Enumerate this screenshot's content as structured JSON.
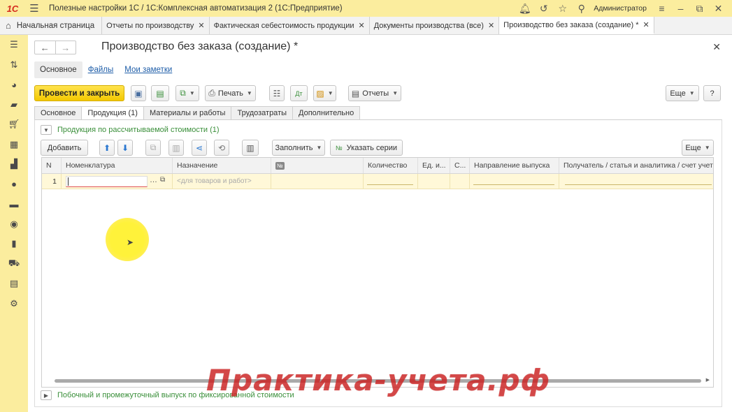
{
  "app": {
    "logo": "1С",
    "title": "Полезные настройки 1С / 1С:Комплексная автоматизация 2  (1С:Предприятие)",
    "user": "Администратор"
  },
  "tabs": {
    "home": "Начальная страница",
    "items": [
      {
        "label": "Отчеты по производству"
      },
      {
        "label": "Фактическая себестоимость продукции"
      },
      {
        "label": "Документы производства (все)"
      },
      {
        "label": "Производство без заказа (создание) *"
      }
    ]
  },
  "form": {
    "title": "Производство без заказа (создание) *",
    "subtabs": [
      "Основное",
      "Файлы",
      "Мои заметки"
    ],
    "toolbar": {
      "post_close": "Провести и закрыть",
      "print": "Печать",
      "reports": "Отчеты",
      "more": "Еще",
      "help": "?"
    },
    "pagetabs": [
      "Основное",
      "Продукция (1)",
      "Материалы и работы",
      "Трудозатраты",
      "Дополнительно"
    ],
    "group1_title": "Продукция по рассчитываемой стоимости (1)",
    "table_toolbar": {
      "add": "Добавить",
      "fill": "Заполнить",
      "series": "Указать серии",
      "more": "Еще"
    },
    "columns": [
      "N",
      "Номенклатура",
      "Назначение",
      "№",
      "Количество",
      "Ед. и...",
      "С...",
      "Направление выпуска",
      "Получатель / статья и аналитика / счет учета"
    ],
    "rows": [
      {
        "n": "1",
        "nomenclature": "",
        "purpose_placeholder": "<для товаров и работ>"
      }
    ],
    "group2_title": "Побочный и промежуточный выпуск по фиксированной стоимости"
  },
  "watermark": "Практика-учета.рф",
  "colors": {
    "panel_yellow": "#fbed9e",
    "primary_button": "#f3c800",
    "group_title": "#3a8f3a",
    "link": "#1e5da8",
    "watermark": "#d22828"
  }
}
